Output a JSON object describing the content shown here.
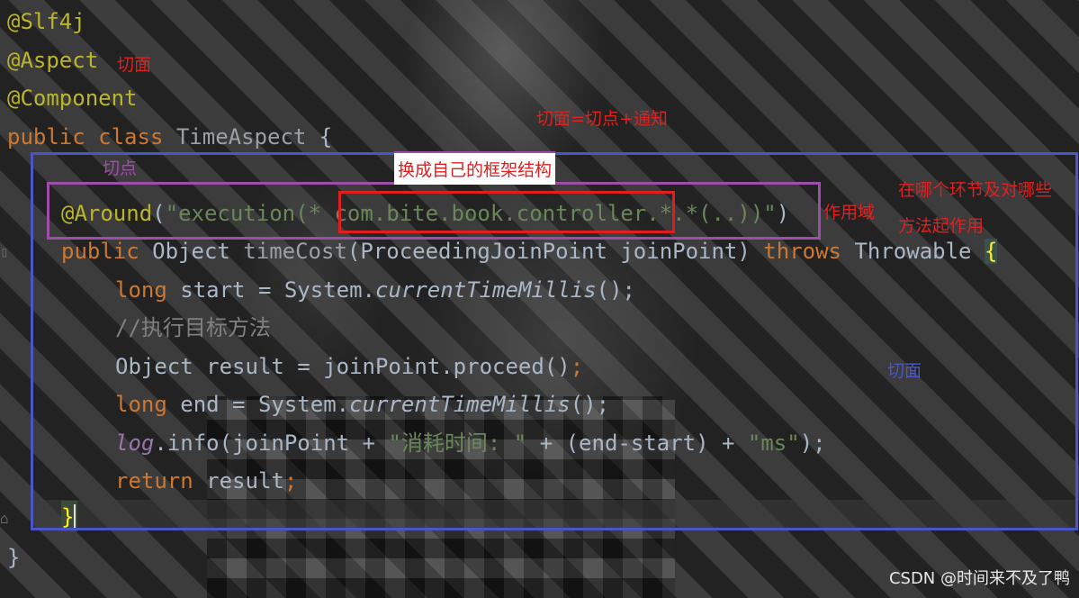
{
  "code": {
    "l1": "@Slf4j",
    "l2": "@Aspect",
    "l3": "@Component",
    "l4_kw": "public class",
    "l4_name": "TimeAspect",
    "l4_brace": "{",
    "l5_ann": "@Around",
    "l5_open": "(",
    "l5_str_a": "\"execution(* ",
    "l5_pkg": "com.bite.book.controller",
    "l5_str_b": ".*.*(..))\"",
    "l5_close": ")",
    "l6_kw": "public",
    "l6_type": "Object",
    "l6_name": "timeCost",
    "l6_params": "(ProceedingJoinPoint joinPoint)",
    "l6_throws": "throws",
    "l6_exc": "Throwable",
    "l6_brace": "{",
    "l7_kw": "long",
    "l7_rest": "start = System.",
    "l7_fn": "currentTimeMillis",
    "l7_end": "();",
    "l8_comment": "//执行目标方法",
    "l9_a": "Object result = joinPoint.proceed()",
    "l9_semi": ";",
    "l10_kw": "long",
    "l10_rest": "end = System.",
    "l10_fn": "currentTimeMillis",
    "l10_end": "();",
    "l11_log": "log",
    "l11_a": ".info(joinPoint + ",
    "l11_str1": "\"消耗时间: \"",
    "l11_b": " + (end-start) + ",
    "l11_str2": "\"ms\"",
    "l11_c": ");",
    "l12_kw": "return",
    "l12_rest": "result",
    "l12_semi": ";",
    "l13_brace": "}",
    "l14_brace": "}"
  },
  "annotations": {
    "aspect_label": "切面",
    "aspect_formula": "切面=切点+通知",
    "pointcut_label": "切点",
    "replace_label": "换成自己的框架结构",
    "scope_label": "作用域",
    "where_label_1": "在哪个环节及对哪些",
    "where_label_2": "方法起作用",
    "aspect_label_2": "切面"
  },
  "watermark": "CSDN @时间来不及了鸭",
  "colors": {
    "red": "#e02020",
    "blue_box": "#4a55c8",
    "purple_box": "#9b4fa8",
    "red_box": "#e01e1e"
  }
}
